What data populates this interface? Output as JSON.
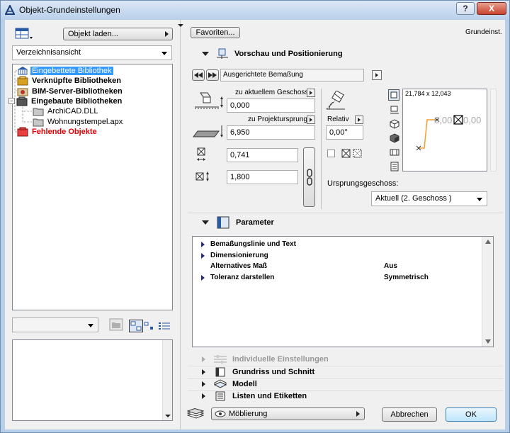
{
  "window": {
    "title": "Objekt-Grundeinstellungen",
    "help_label": "?",
    "close_label": "X"
  },
  "left": {
    "load_object_button": "Objekt laden...",
    "view_select": "Verzeichnisansicht",
    "tree": [
      {
        "label": "Eingebettete Bibliothek",
        "style": "selected",
        "indent": 0
      },
      {
        "label": "Verknüpfte Bibliotheken",
        "style": "bold",
        "indent": 0
      },
      {
        "label": "BIM-Server-Bibliotheken",
        "style": "bold",
        "indent": 0
      },
      {
        "label": "Eingebaute Bibliotheken",
        "style": "bold",
        "indent": 0
      },
      {
        "label": "ArchiCAD.DLL",
        "style": "normal",
        "indent": 1
      },
      {
        "label": "Wohnungstempel.apx",
        "style": "normal",
        "indent": 1
      },
      {
        "label": "Fehlende Objekte",
        "style": "missing",
        "indent": 0
      }
    ],
    "colors": {
      "missing": "#e00000",
      "selected_bg": "#3399ff",
      "library_icon": "#d8a020"
    }
  },
  "header": {
    "favorites_button": "Favoriten...",
    "mode_label": "Grundeinst."
  },
  "preview": {
    "section_title": "Vorschau und Positionierung",
    "object_name": "Ausgerichtete Bemaßung",
    "height_story_label": "zu aktuellem Geschoss",
    "height_story_value": "0,000",
    "height_origin_label": "zu Projektursprung",
    "height_origin_value": "6,950",
    "x_value": "0,741",
    "y_value": "1,800",
    "relative_label": "Relativ",
    "angle_value": "0,00°",
    "preview_size": "21,784 x 12,043",
    "preview_text": "0,00",
    "origin_story_label": "Ursprungsgeschoss:",
    "origin_story_value": "Aktuell (2. Geschoss )"
  },
  "parameters": {
    "section_title": "Parameter",
    "rows": [
      {
        "label": "Bemaßungslinie und Text",
        "value": "",
        "expandable": true
      },
      {
        "label": "Dimensionierung",
        "value": "",
        "expandable": true
      },
      {
        "label": "Alternatives Maß",
        "value": "Aus",
        "expandable": false
      },
      {
        "label": "Toleranz darstellen",
        "value": "Symmetrisch",
        "expandable": true
      }
    ]
  },
  "sections": [
    {
      "label": "Individuelle Einstellungen",
      "disabled": true
    },
    {
      "label": "Grundriss und Schnitt",
      "disabled": false
    },
    {
      "label": "Modell",
      "disabled": false
    },
    {
      "label": "Listen und Etiketten",
      "disabled": false
    }
  ],
  "footer": {
    "layer_select": "Möblierung",
    "cancel_button": "Abbrechen",
    "ok_button": "OK"
  }
}
